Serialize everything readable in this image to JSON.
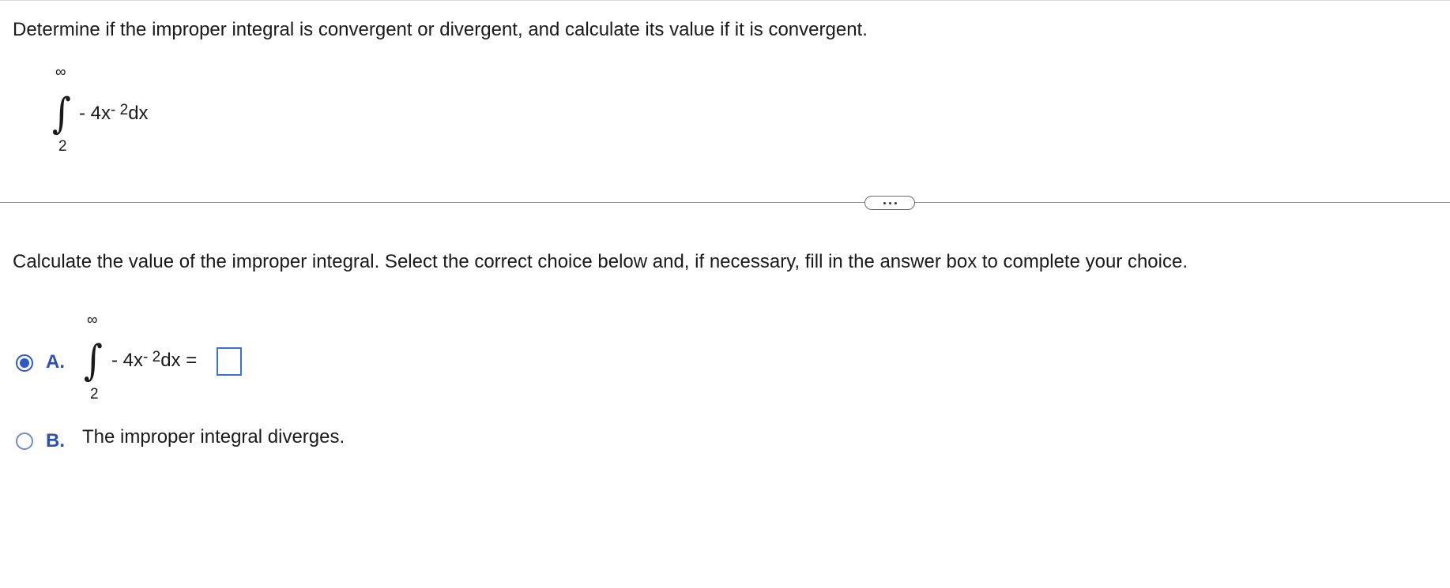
{
  "question": {
    "prompt": "Determine if the improper integral is convergent or divergent, and calculate its value if it is convergent.",
    "integral": {
      "upper": "∞",
      "lower": "2",
      "sign": "∫",
      "integrand_prefix": "- 4x",
      "exponent": "- 2",
      "differential": "dx"
    }
  },
  "more_button": {
    "icon": "ellipsis-icon"
  },
  "part": {
    "instruction": "Calculate the value of the improper integral. Select the correct choice below and, if necessary, fill in the answer box to complete your choice.",
    "choices": [
      {
        "letter": "A.",
        "selected": true,
        "integral": {
          "upper": "∞",
          "lower": "2",
          "sign": "∫",
          "integrand_prefix": "- 4x",
          "exponent": "- 2",
          "differential": "dx ="
        },
        "answer_value": ""
      },
      {
        "letter": "B.",
        "selected": false,
        "text": "The improper integral diverges."
      }
    ]
  },
  "colors": {
    "accent": "#2c59c9",
    "choice_letter": "#2c50b8",
    "divider": "#8f8f8f"
  }
}
